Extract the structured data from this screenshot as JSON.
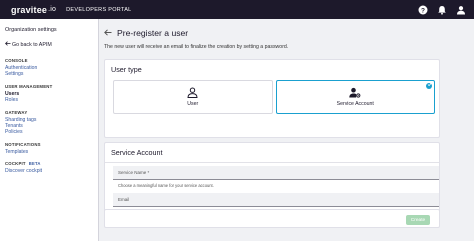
{
  "topbar": {
    "logo_text": "gravitee",
    "logo_suffix": ".io",
    "portal_label": "DEVELOPERS PORTAL",
    "icons": [
      "help-icon",
      "bell-icon",
      "user-icon"
    ]
  },
  "sidebar": {
    "title": "Organization settings",
    "back_label": "Go back to APIM",
    "sections": [
      {
        "label": "CONSOLE",
        "items": [
          "Authentication",
          "Settings"
        ]
      },
      {
        "label": "USER MANAGEMENT",
        "items": [
          "Users",
          "Roles"
        ]
      },
      {
        "label": "GATEWAY",
        "items": [
          "Sharding tags",
          "Tenants",
          "Policies"
        ]
      },
      {
        "label": "NOTIFICATIONS",
        "items": [
          "Templates"
        ]
      },
      {
        "label": "COCKPIT",
        "badge": "BETA",
        "items": [
          "Discover cockpit"
        ]
      }
    ]
  },
  "main": {
    "title": "Pre-register a user",
    "subtitle": "The new user will receive an email to finalize the creation by setting a password.",
    "user_type": {
      "title": "User type",
      "options": [
        {
          "label": "User",
          "icon": "person-icon",
          "selected": false
        },
        {
          "label": "Service Account",
          "icon": "service-account-icon",
          "selected": true
        }
      ]
    },
    "service_account": {
      "title": "Service Account",
      "name_placeholder": "Service Name *",
      "name_hint": "Choose a meaningful name for your service account.",
      "email_placeholder": "Email"
    },
    "create_label": "Create"
  },
  "colors": {
    "topbar": "#1d192b",
    "accent": "#1aa0cf",
    "link": "#3a5ba0",
    "create_disabled": "#a8d8b4"
  }
}
